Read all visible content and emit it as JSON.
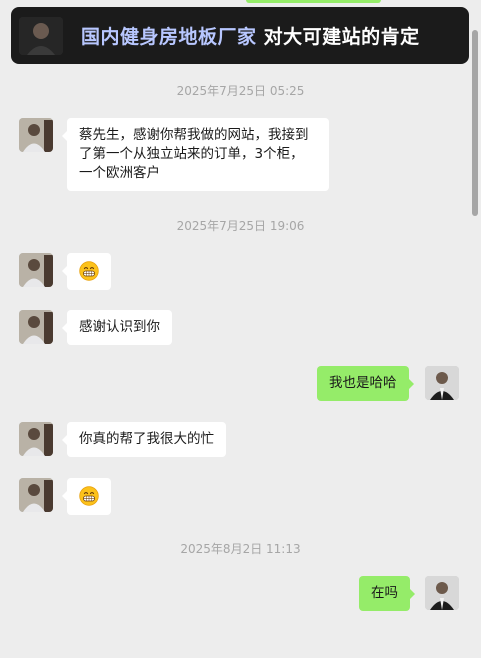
{
  "banner": {
    "title_highlight": "国内健身房地板厂家",
    "title_rest": " 对大可建站的肯定"
  },
  "messages": {
    "t1": "2025年7月25日 05:25",
    "m1": "蔡先生，感谢你帮我做的网站，我接到了第一个从独立站来的订单，3个柜，一个欧洲客户",
    "t2": "2025年7月25日 19:06",
    "m2_emoji": "grinning-face-icon",
    "m3": "感谢认识到你",
    "m4": "我也是哈哈",
    "m5": "你真的帮了我很大的忙",
    "m6_emoji": "grinning-face-icon",
    "t3": "2025年8月2日 11:13",
    "m7": "在吗"
  },
  "colors": {
    "background": "#ededed",
    "self_bubble": "#95ec69",
    "other_bubble": "#ffffff",
    "banner_bg": "#1b1b1b",
    "banner_highlight": "#b8c7ff",
    "timestamp": "#a6a6a6"
  }
}
